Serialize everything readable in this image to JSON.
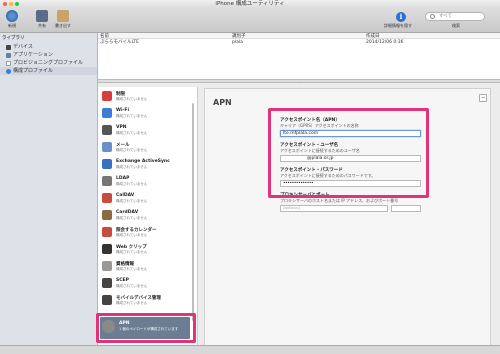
{
  "window": {
    "title": "iPhone 構成ユーティリティ"
  },
  "toolbar": {
    "buttons": [
      {
        "label": "新規",
        "icon": "gear-add-icon"
      },
      {
        "label": "共有",
        "icon": "share-icon"
      },
      {
        "label": "書き出す",
        "icon": "export-box-icon"
      }
    ],
    "info_label": "詳細情報を隠す",
    "search_placeholder": "すべて",
    "search_label": "検索"
  },
  "sidebar": {
    "header": "ライブラリ",
    "items": [
      {
        "label": "デバイス",
        "icon": "device-icon",
        "selected": false
      },
      {
        "label": "アプリケーション",
        "icon": "app-icon",
        "selected": false
      },
      {
        "label": "プロビジョニングプロファイル",
        "icon": "provisioning-icon",
        "selected": false
      },
      {
        "label": "構成プロファイル",
        "icon": "config-profile-icon",
        "selected": true
      }
    ]
  },
  "list": {
    "columns": [
      "名前",
      "識別子",
      "作成日"
    ],
    "rows": [
      {
        "name": "ぷららモバイルLTE",
        "identifier": "plala",
        "created": "2014/12/06 0:36"
      }
    ]
  },
  "payloads": [
    {
      "title": "制限",
      "sub": "構成されていません",
      "icon": "restrictions-icon",
      "color": "#d93c3c"
    },
    {
      "title": "Wi-Fi",
      "sub": "構成されていません",
      "icon": "wifi-icon",
      "color": "#3a7ed8"
    },
    {
      "title": "VPN",
      "sub": "構成されていません",
      "icon": "vpn-icon",
      "color": "#555555"
    },
    {
      "title": "メール",
      "sub": "構成されていません",
      "icon": "mail-icon",
      "color": "#6b8fc9"
    },
    {
      "title": "Exchange ActiveSync",
      "sub": "構成されていません",
      "icon": "exchange-icon",
      "color": "#3b6fc1"
    },
    {
      "title": "LDAP",
      "sub": "構成されていません",
      "icon": "ldap-icon",
      "color": "#777777"
    },
    {
      "title": "CalDAV",
      "sub": "構成されていません",
      "icon": "caldav-icon",
      "color": "#c94a3e"
    },
    {
      "title": "CardDAV",
      "sub": "構成されていません",
      "icon": "carddav-icon",
      "color": "#8a6a3e"
    },
    {
      "title": "照会するカレンダー",
      "sub": "構成されていません",
      "icon": "subscribed-calendar-icon",
      "color": "#c94a3e"
    },
    {
      "title": "Web クリップ",
      "sub": "構成されていません",
      "icon": "webclip-icon",
      "color": "#333333"
    },
    {
      "title": "資格情報",
      "sub": "構成されていません",
      "icon": "credentials-icon",
      "color": "#999999"
    },
    {
      "title": "SCEP",
      "sub": "構成されていません",
      "icon": "scep-icon",
      "color": "#444444"
    },
    {
      "title": "モバイルデバイス管理",
      "sub": "構成されていません",
      "icon": "mdm-icon",
      "color": "#444444"
    },
    {
      "title": "APN",
      "sub": "1 個のペイロードが構成されています",
      "icon": "apn-gear-icon",
      "color": "#8a8a8a",
      "selected": true
    }
  ],
  "apn": {
    "title": "APN",
    "access_point": {
      "label": "アクセスポイント名（APN）",
      "desc": "キャリア（GPRS）アクセスポイントの名称",
      "value": "lte.mfplala.com"
    },
    "username": {
      "label": "アクセスポイント・ユーザ名",
      "desc": "アクセスポイントに接続するためのユーザ名",
      "value": "@plala.or.jp"
    },
    "password": {
      "label": "アクセスポイント・パスワード",
      "desc": "アクセスポイントに接続するためのパスワードです。",
      "value": "••••••••••••••"
    },
    "proxy": {
      "label": "プロキシサーバとポート",
      "desc": "プロキシサーバのホスト名または IP アドレス、およびポート番号",
      "placeholder": "[optional]"
    }
  },
  "colors": {
    "highlight": "#e0337a",
    "accent": "#2a6fd6"
  }
}
